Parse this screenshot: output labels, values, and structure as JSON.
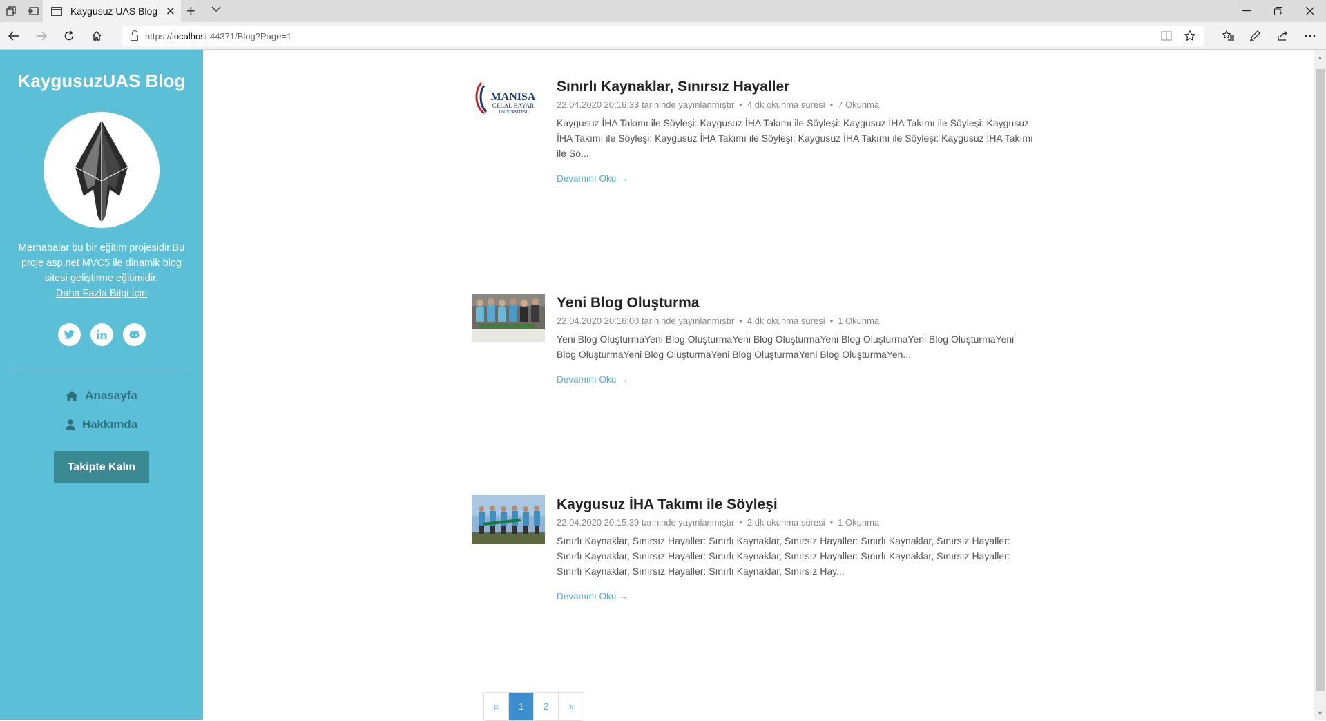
{
  "browser": {
    "tab_title": "Kaygusuz UAS Blog",
    "url_scheme": "https://",
    "url_host": "localhost",
    "url_rest": ":44371/Blog?Page=1"
  },
  "sidebar": {
    "brand": "KaygusuzUAS Blog",
    "intro_text": "Merhabalar bu bir eğitim projesidir.Bu proje asp.net MVC5 ile dinamik blog sitesi geliştirme eğitimidir.",
    "more_info_link": "Daha Fazla Bilgi İçin",
    "social_icons": [
      "twitter-icon",
      "linkedin-icon",
      "github-icon"
    ],
    "nav": [
      {
        "label": "Anasayfa",
        "icon": "home-icon"
      },
      {
        "label": "Hakkımda",
        "icon": "user-icon"
      }
    ],
    "follow_button": "Takipte Kalın",
    "color": "#5bc0d7"
  },
  "posts": [
    {
      "title": "Sınırlı Kaynaklar, Sınırsız Hayaller",
      "date": "22.04.2020 20:16:33 tarihinde yayınlanmıştır",
      "read_time": "4 dk okunma süresi",
      "reads": "7 Okunma",
      "excerpt": "Kaygusuz İHA Takımı ile Söyleşi: Kaygusuz İHA Takımı ile Söyleşi: Kaygusuz İHA Takımı ile Söyleşi: Kaygusuz İHA Takımı ile Söyleşi: Kaygusuz İHA Takımı ile Söyleşi: Kaygusuz İHA Takımı ile Söyleşi: Kaygusuz İHA Takımı ile Sö...",
      "read_more": "Devamını Oku →",
      "thumb_logo": {
        "line1": "MANISA",
        "line2": "CELAL BAYAR",
        "line3": "ÜNİVERSİTESİ"
      }
    },
    {
      "title": "Yeni Blog Oluşturma",
      "date": "22.04.2020 20:16:00 tarihinde yayınlanmıştır",
      "read_time": "4 dk okunma süresi",
      "reads": "1 Okunma",
      "excerpt": "Yeni Blog OluşturmaYeni Blog OluşturmaYeni Blog OluşturmaYeni Blog OluşturmaYeni Blog OluşturmaYeni Blog OluşturmaYeni Blog OluşturmaYeni Blog OluşturmaYeni Blog OluşturmaYen...",
      "read_more": "Devamını Oku →"
    },
    {
      "title": "Kaygusuz İHA Takımı ile Söyleşi",
      "date": "22.04.2020 20:15:39 tarihinde yayınlanmıştır",
      "read_time": "2 dk okunma süresi",
      "reads": "1 Okunma",
      "excerpt": "Sınırlı Kaynaklar, Sınırsız Hayaller: Sınırlı Kaynaklar, Sınırsız Hayaller: Sınırlı Kaynaklar, Sınırsız Hayaller: Sınırlı Kaynaklar, Sınırsız Hayaller: Sınırlı Kaynaklar, Sınırsız Hayaller: Sınırlı Kaynaklar, Sınırsız Hayaller: Sınırlı Kaynaklar, Sınırsız Hayaller: Sınırlı Kaynaklar, Sınırsız Hay...",
      "read_more": "Devamını Oku →"
    }
  ],
  "pagination": {
    "prev": "«",
    "pages": [
      "1",
      "2"
    ],
    "active": "1",
    "next": "»"
  }
}
